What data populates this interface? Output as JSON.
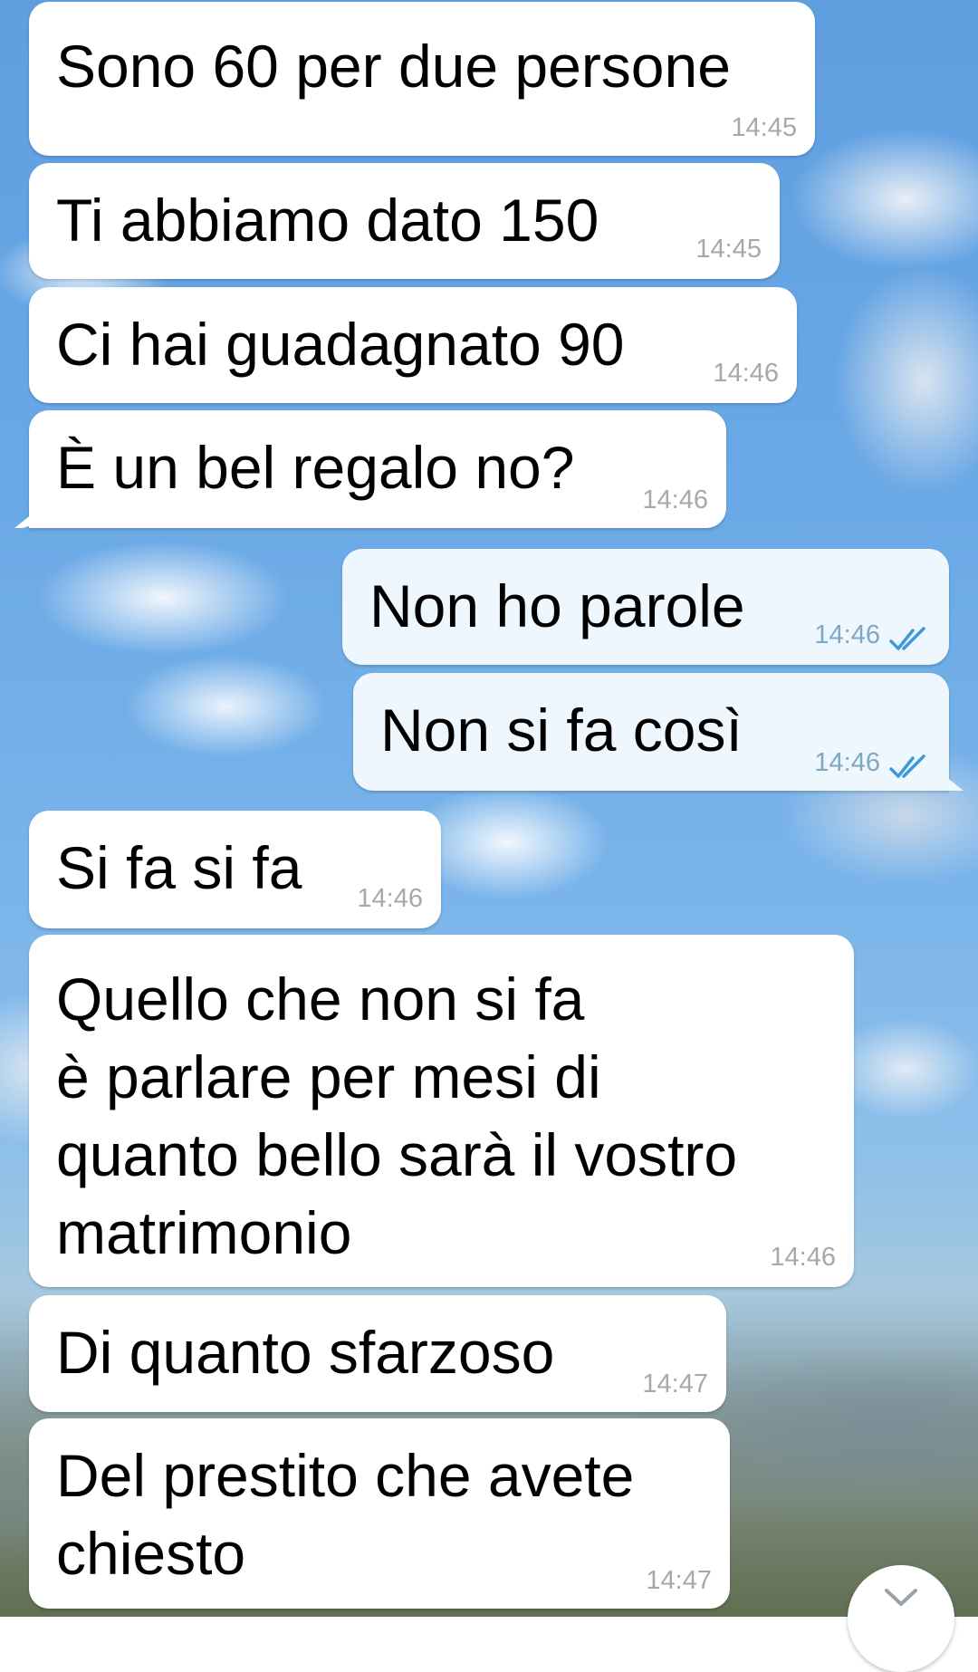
{
  "conversation": {
    "messages": [
      {
        "direction": "incoming",
        "text": "Sono 60 per due persone",
        "time": "14:45"
      },
      {
        "direction": "incoming",
        "text": "Ti abbiamo dato 150",
        "time": "14:45"
      },
      {
        "direction": "incoming",
        "text": "Ci hai guadagnato 90",
        "time": "14:46"
      },
      {
        "direction": "incoming",
        "text": "È un bel regalo no?",
        "time": "14:46"
      },
      {
        "direction": "outgoing",
        "text": "Non ho parole",
        "time": "14:46",
        "status": "read"
      },
      {
        "direction": "outgoing",
        "text": "Non si fa così",
        "time": "14:46",
        "status": "read"
      },
      {
        "direction": "incoming",
        "text": "Si fa si fa",
        "time": "14:46"
      },
      {
        "direction": "incoming",
        "lines": [
          "Quello che non si fa",
          "è parlare per mesi di",
          "quanto bello sarà il vostro",
          "matrimonio"
        ],
        "time": "14:46"
      },
      {
        "direction": "incoming",
        "text": "Di quanto sfarzoso",
        "time": "14:47"
      },
      {
        "direction": "incoming",
        "lines": [
          "Del prestito che avete",
          "chiesto"
        ],
        "time": "14:47"
      }
    ]
  },
  "icons": {
    "read_receipt": "double-check-icon",
    "scroll_down": "chevron-down-icon"
  },
  "colors": {
    "incoming_bubble": "#ffffff",
    "outgoing_bubble": "#eff7fe",
    "timestamp": "#a8a8a8",
    "outgoing_timestamp": "#7fa7c4",
    "read_check": "#3d9ad8"
  }
}
